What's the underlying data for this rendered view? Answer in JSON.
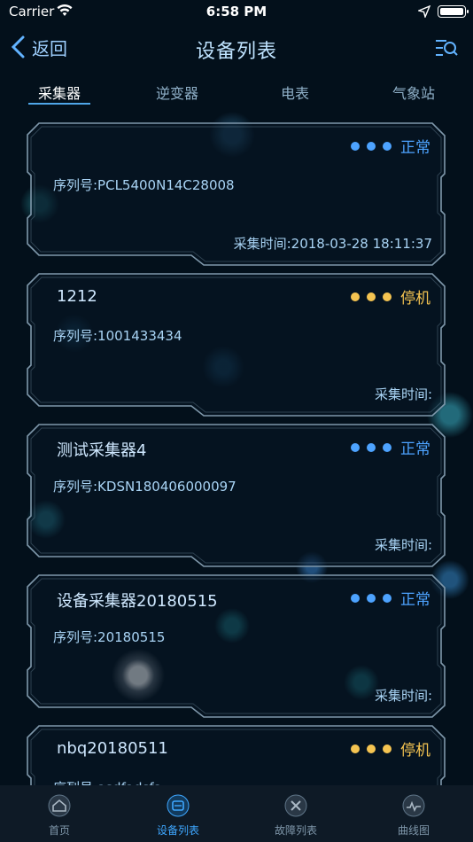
{
  "status_bar": {
    "carrier": "Carrier",
    "time": "6:58 PM"
  },
  "nav": {
    "back_label": "返回",
    "title": "设备列表"
  },
  "tabs": [
    {
      "label": "采集器",
      "active": true
    },
    {
      "label": "逆变器"
    },
    {
      "label": "电表"
    },
    {
      "label": "气象站"
    }
  ],
  "colors": {
    "normal": "#4da3ff",
    "stopped": "#f5c451",
    "accent": "#3ea7ff"
  },
  "devices": [
    {
      "name": "",
      "status": "正常",
      "status_type": "normal",
      "serial": "序列号:PCL5400N14C28008",
      "time": "采集时间:2018-03-28 18:11:37"
    },
    {
      "name": "1212",
      "status": "停机",
      "status_type": "stopped",
      "serial": "序列号:1001433434",
      "time": "采集时间:"
    },
    {
      "name": "测试采集器4",
      "status": "正常",
      "status_type": "normal",
      "serial": "序列号:KDSN180406000097",
      "time": "采集时间:"
    },
    {
      "name": "设备采集器20180515",
      "status": "正常",
      "status_type": "normal",
      "serial": "序列号:20180515",
      "time": "采集时间:"
    },
    {
      "name": "nbq20180511",
      "status": "停机",
      "status_type": "stopped",
      "serial": "序列号:asdfadsfa",
      "time": ""
    }
  ],
  "tabbar": [
    {
      "label": "首页",
      "icon": "home-icon"
    },
    {
      "label": "设备列表",
      "icon": "device-list-icon",
      "active": true
    },
    {
      "label": "故障列表",
      "icon": "fault-icon"
    },
    {
      "label": "曲线图",
      "icon": "curve-icon"
    }
  ]
}
